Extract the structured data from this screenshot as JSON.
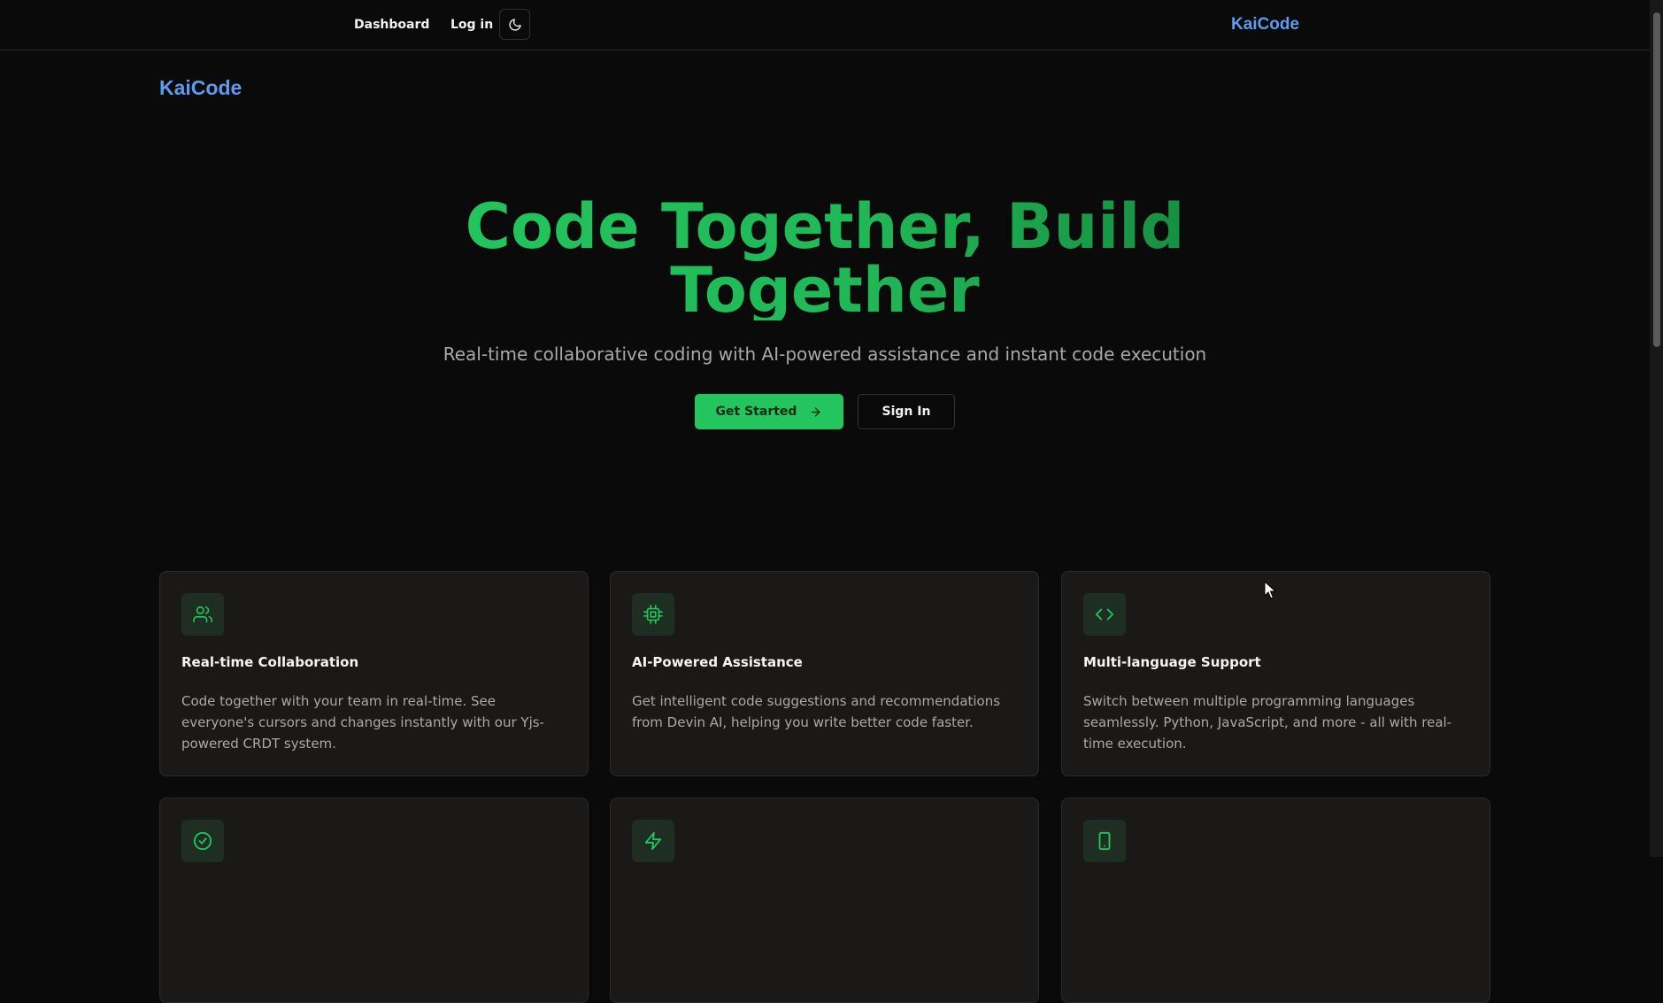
{
  "nav": {
    "dashboard_label": "Dashboard",
    "login_label": "Log in",
    "theme_icon": "moon-icon",
    "brand": "KaiCode"
  },
  "page": {
    "brand": "KaiCode"
  },
  "hero": {
    "title": "Code Together, Build Together",
    "subtitle": "Real-time collaborative coding with AI-powered assistance and instant code execution",
    "primary_label": "Get Started",
    "primary_icon": "arrow-right-icon",
    "secondary_label": "Sign In"
  },
  "features": [
    {
      "icon": "users-icon",
      "title": "Real-time Collaboration",
      "description": "Code together with your team in real-time. See everyone's cursors and changes instantly with our Yjs-powered CRDT system."
    },
    {
      "icon": "cpu-icon",
      "title": "AI-Powered Assistance",
      "description": "Get intelligent code suggestions and recommendations from Devin AI, helping you write better code faster."
    },
    {
      "icon": "code-icon",
      "title": "Multi-language Support",
      "description": "Switch between multiple programming languages seamlessly. Python, JavaScript, and more - all with real-time execution."
    },
    {
      "icon": "check-circle-icon"
    },
    {
      "icon": "lightning-icon"
    },
    {
      "icon": "smartphone-icon"
    }
  ],
  "colors": {
    "accent_green": "#22c55e",
    "brand_blue": "#5b9cf0",
    "background": "#0b0a0a",
    "card_background": "#1a1918"
  }
}
